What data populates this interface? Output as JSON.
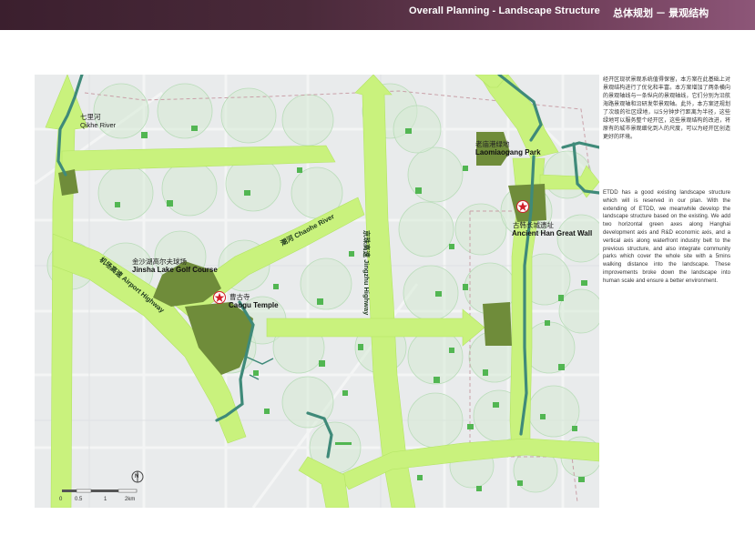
{
  "header": {
    "title_en": "Overall Planning - Landscape Structure",
    "title_cn": "总体规划 － 景观结构"
  },
  "map": {
    "labels": {
      "qikhe_cn": "七里河",
      "qikhe_en": "Qikhe River",
      "laomiao_cn": "老庙港绿地",
      "laomiao_en": "Laomiaogang Park",
      "hanwall_cn": "古韩长城遗址",
      "hanwall_en": "Ancient Han Great Wall",
      "golf_cn": "金沙湖高尔夫球场",
      "golf_en": "Jinsha Lake Golf Course",
      "temple_cn": "曹古寺",
      "temple_en": "Caogu Temple",
      "chaohe": "潮河  Chaohe River",
      "airport": "机场高速  Airport Highway",
      "jingzhu": "京珠高速  Jingzhu Highway"
    },
    "scale": {
      "ticks": [
        "0",
        "0.5",
        "1",
        "2km"
      ]
    },
    "compass": "N",
    "colors": {
      "axis": "#c9f27d",
      "park": "#6f8c3a",
      "river": "#3f8a79",
      "circle": "#d6ecd6",
      "boundary": "#c9a0a8"
    }
  },
  "sidebar": {
    "text_cn": "经开区现状景观系统值得保留，本方案在此基础上对景观结构进行了优化和丰富。本方案增加了两条横向的景观轴线与一条纵向的景观轴线，它们分别为沿航海路景观轴和沿研发带景观轴。此外，本方案还规划了次级的社区绿地，以5分钟步行距离为半径，这些绿地可以服务整个经开区，这些景观结构的改进，将原有的城市景观细化到人的尺度，可以为经开区创造更好的环境。",
    "text_en": "ETDD has a good existing landscape structure which will is reserved in our plan. With the extending of ETDD, we meanwhile develop the landscape structure based on the existing. We add two horizontal green axes along Hanghai development axis and R&D economic axis, and a vertical axis along waterfront industry belt to the previous structure, and also integrate community parks which cover the whole site with a 5mins walking distance into the landscape. These improvements broke down the landscape into human scale and ensure a better environment."
  }
}
